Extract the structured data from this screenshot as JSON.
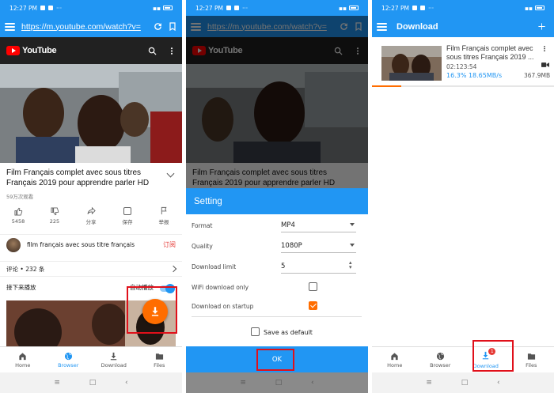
{
  "status": {
    "time": "12:27 PM",
    "battery_icon": "battery-icon"
  },
  "browser": {
    "url": "https://m.youtube.com/watch?v=",
    "yt_name": "YouTube",
    "video_title": "Film Français complet avec sous titres Français 2019 pour apprendre parler HD",
    "views": "59万次观看",
    "actions": [
      {
        "label": "5458"
      },
      {
        "label": "225"
      },
      {
        "label": "分享"
      },
      {
        "label": "保存"
      },
      {
        "label": "举报"
      }
    ],
    "channel_name": "film français avec sous titre français",
    "subscribe": "订阅",
    "comments": "评论 • 232 条",
    "up_next": "接下来播放",
    "autoplay": "自动播放"
  },
  "bottom_nav": [
    {
      "label": "Home",
      "icon": "home-icon"
    },
    {
      "label": "Browser",
      "icon": "globe-icon"
    },
    {
      "label": "Download",
      "icon": "download-icon"
    },
    {
      "label": "Files",
      "icon": "folder-icon"
    }
  ],
  "settings": {
    "title": "Setting",
    "format_label": "Format",
    "format_value": "MP4",
    "quality_label": "Quality",
    "quality_value": "1080P",
    "limit_label": "Download limit",
    "limit_value": "5",
    "wifi_label": "WiFi download only",
    "startup_label": "Download on startup",
    "default_label": "Save as default",
    "ok": "OK"
  },
  "downloads": {
    "title": "Download",
    "item_title": "Film Français complet avec sous titres Français 2019 ...",
    "duration": "02:123:54",
    "progress": "16.3% 18.65MB/s",
    "progress_fraction": 0.163,
    "size": "367.9MB",
    "badge_count": "1"
  },
  "colors": {
    "primary": "#2196f3",
    "accent": "#ff6d00",
    "highlight": "#e0101a"
  }
}
